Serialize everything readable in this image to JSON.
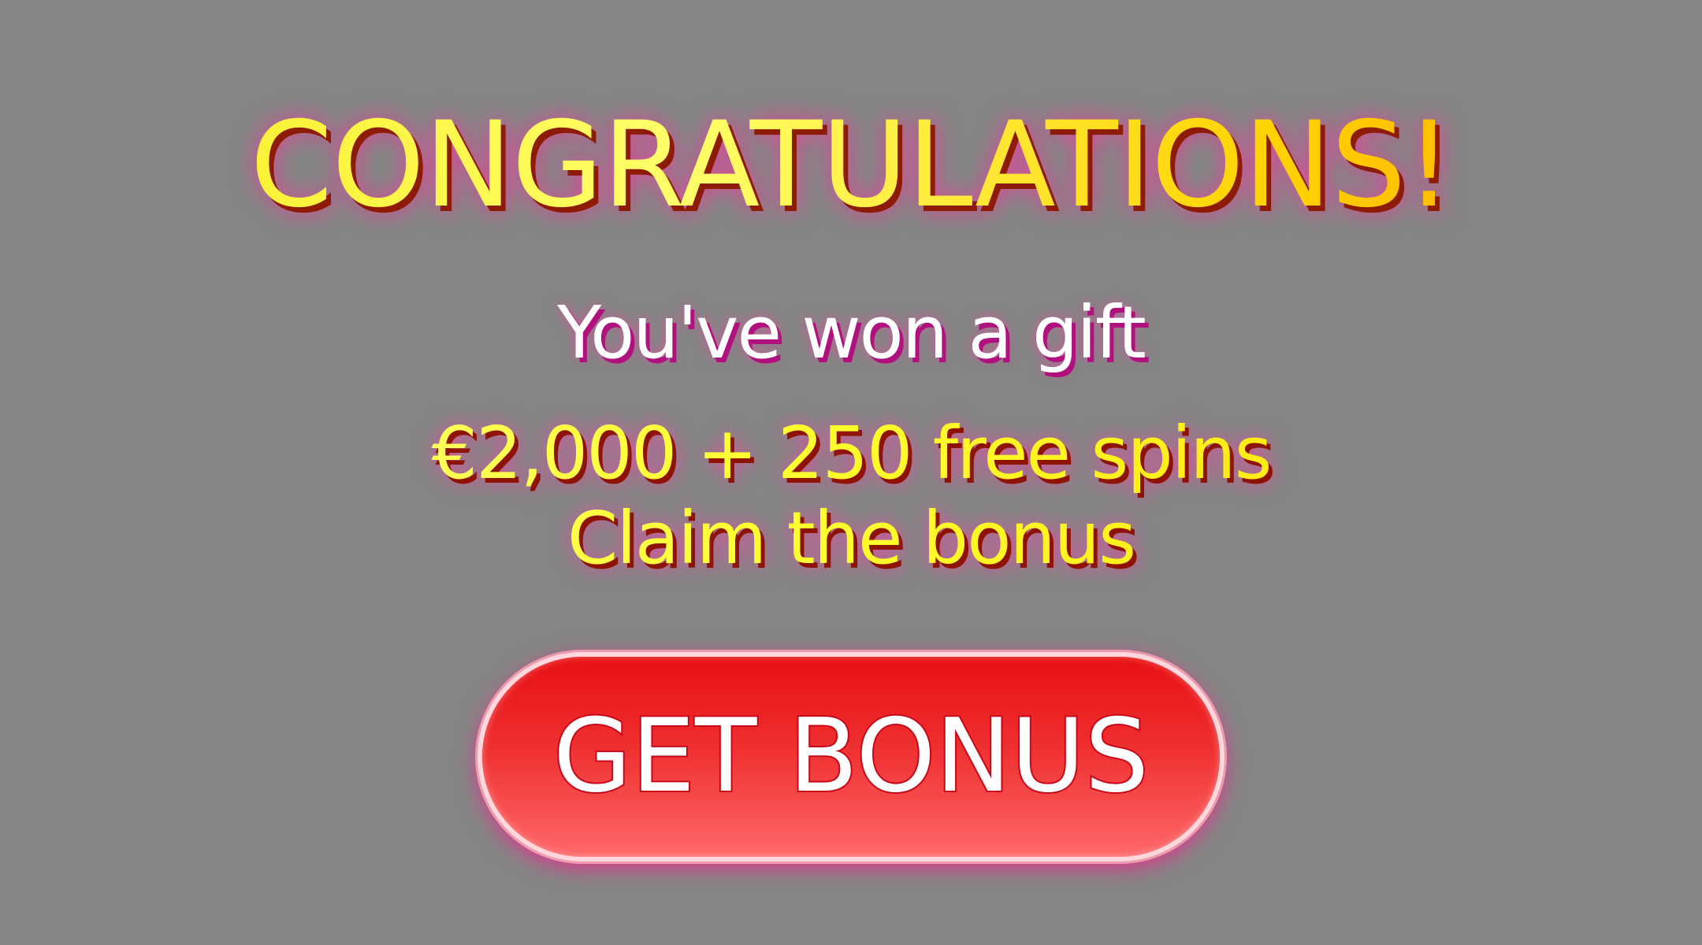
{
  "popup": {
    "headline": "CONGRATULATIONS!",
    "subtitle": "You've won a gift",
    "offer_line": "€2,000 + 250 free spins",
    "claim_line": "Claim the bonus"
  },
  "cta": {
    "label": "GET BONUS"
  },
  "colors": {
    "background": "#858585",
    "headline_start": "#f7ea1a",
    "headline_end": "#ff9f00",
    "button_top": "#e80f12",
    "button_bottom": "#ff6869",
    "glow": "#f22691"
  }
}
